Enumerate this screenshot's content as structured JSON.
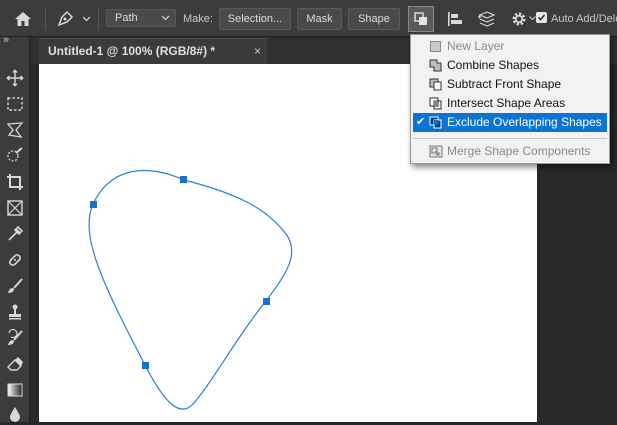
{
  "options_bar": {
    "path_mode": "Path",
    "make_label": "Make:",
    "selection_button": "Selection...",
    "mask_button": "Mask",
    "shape_button": "Shape",
    "auto_add_delete_label": "Auto Add/Delete"
  },
  "document": {
    "tab_title": "Untitled-1 @ 100% (RGB/8#) *",
    "close_glyph": "×",
    "panel_toggle_glyph": "»"
  },
  "path_operations_menu": {
    "items": [
      {
        "label": "New Layer",
        "state": "disabled",
        "icon": "new-layer-icon"
      },
      {
        "label": "Combine Shapes",
        "state": "enabled",
        "icon": "combine-shapes-icon"
      },
      {
        "label": "Subtract Front Shape",
        "state": "enabled",
        "icon": "subtract-front-shape-icon"
      },
      {
        "label": "Intersect Shape Areas",
        "state": "enabled",
        "icon": "intersect-shape-areas-icon"
      },
      {
        "label": "Exclude Overlapping Shapes",
        "state": "selected",
        "icon": "exclude-overlapping-shapes-icon"
      },
      {
        "label": "Merge Shape Components",
        "state": "disabled",
        "icon": "merge-shape-components-icon"
      }
    ],
    "check_glyph": "✔"
  },
  "colors": {
    "accent_selection": "#0a74d6",
    "path_stroke": "#2b7fd4",
    "anchor_fill": "#1f6fc8"
  }
}
